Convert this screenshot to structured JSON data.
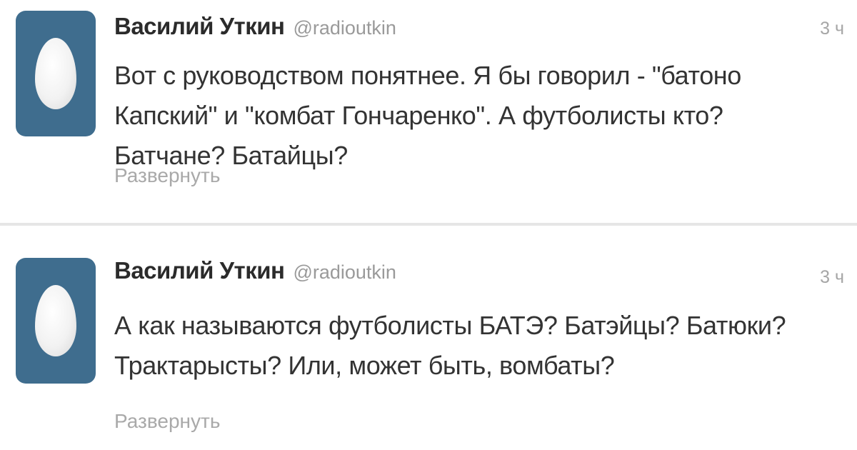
{
  "tweets": [
    {
      "fullname": "Василий Уткин",
      "username": "@radioutkin",
      "time": "3 ч",
      "text": "Вот с руководством понятнее. Я бы говорил - \"батоно Капский\" и \"комбат Гончаренко\". А футболисты кто? Батчане? Батайцы?",
      "expand_label": "Развернуть",
      "avatar_icon": "egg-icon"
    },
    {
      "fullname": "Василий Уткин",
      "username": "@radioutkin",
      "time": "3 ч",
      "text": "А как называются футболисты БАТЭ? Батэйцы? Батюки? Трактарысты? Или, может быть, вомбаты?",
      "expand_label": "Развернуть",
      "avatar_icon": "egg-icon"
    }
  ],
  "colors": {
    "avatar_background": "#3f6d8e",
    "name": "#2b2b2b",
    "secondary_text": "#9a9a9a",
    "body_text": "#333333",
    "divider": "#e6e6e6"
  }
}
